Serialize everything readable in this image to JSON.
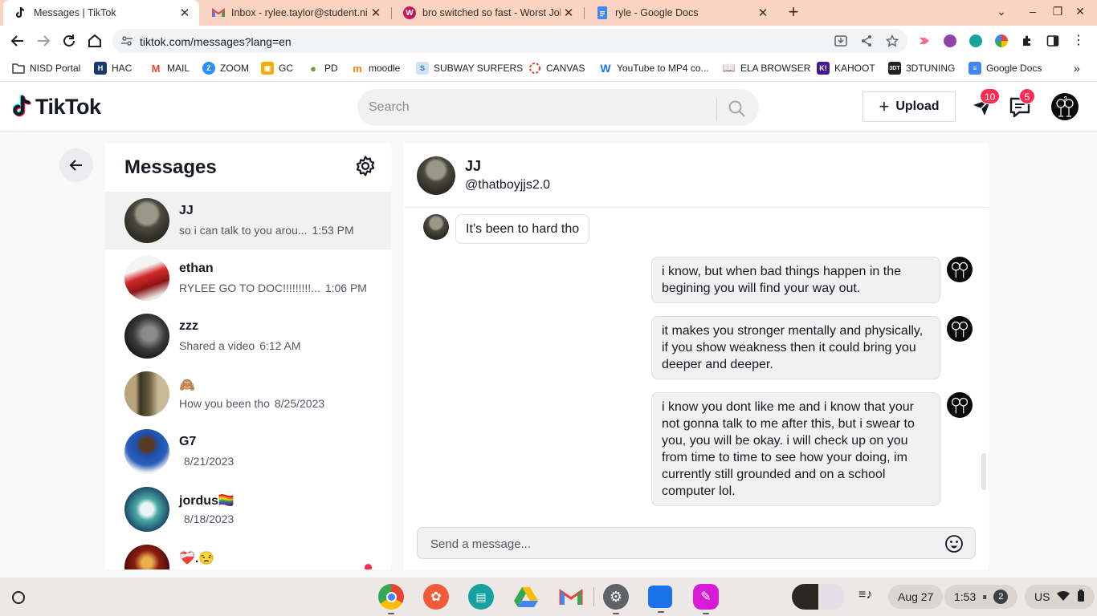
{
  "browser": {
    "tabs": [
      {
        "title": "Messages | TikTok",
        "active": true
      },
      {
        "title": "Inbox - rylee.taylor@student.nisd",
        "active": false
      },
      {
        "title": "bro switched so fast - Worst Jok",
        "active": false
      },
      {
        "title": "ryle - Google Docs",
        "active": false
      }
    ],
    "url": "tiktok.com/messages?lang=en",
    "bookmarks": [
      {
        "label": "NISD Portal"
      },
      {
        "label": "HAC"
      },
      {
        "label": "MAIL"
      },
      {
        "label": "ZOOM"
      },
      {
        "label": "GC"
      },
      {
        "label": "PD"
      },
      {
        "label": "moodle"
      },
      {
        "label": "SUBWAY SURFERS"
      },
      {
        "label": "CANVAS"
      },
      {
        "label": "YouTube to MP4 co..."
      },
      {
        "label": "ELA BROWSER"
      },
      {
        "label": "KAHOOT"
      },
      {
        "label": "3DTUNING"
      },
      {
        "label": "Google Docs"
      }
    ]
  },
  "header": {
    "brand": "TikTok",
    "search_placeholder": "Search",
    "upload_label": "Upload",
    "inbox_badge": "10",
    "messages_badge": "5"
  },
  "conversations": {
    "title": "Messages",
    "items": [
      {
        "name": "JJ",
        "preview": "so i can talk to you arou...",
        "time": "1:53 PM"
      },
      {
        "name": "ethan",
        "preview": "RYLEE GO TO DOC!!!!!!!!!...",
        "time": "1:06 PM"
      },
      {
        "name": "zzz",
        "preview": "Shared a video",
        "time": "6:12 AM"
      },
      {
        "name": "🙈",
        "preview": "How you been tho",
        "time": "8/25/2023"
      },
      {
        "name": "G7",
        "preview": "",
        "time": "8/21/2023"
      },
      {
        "name": "jordus🏳️‍🌈",
        "preview": "",
        "time": "8/18/2023"
      },
      {
        "name": "❤️‍🩹.😒",
        "preview": "",
        "time": ""
      }
    ]
  },
  "chat": {
    "name": "JJ",
    "handle": "@thatboyjjs2.0",
    "messages": [
      {
        "from": "them",
        "text": "It’s been to hard tho"
      },
      {
        "from": "me",
        "text": "i know, but when bad things happen in the begining you will find your way out."
      },
      {
        "from": "me",
        "text": "it makes you stronger mentally and physically, if you show weakness then it could bring you deeper and deeper."
      },
      {
        "from": "me",
        "text": "i know you dont like me and i know that your not gonna talk to me after this, but i swear to you, you will be okay. i will check up on you from time to time to see how your doing, im currently still grounded and on a school computer lol."
      }
    ],
    "composer_placeholder": "Send a message..."
  },
  "shelf": {
    "date": "Aug 27",
    "time": "1:53",
    "notifications": "2",
    "locale": "US"
  },
  "colors": {
    "tiktok_red": "#fe2c55",
    "tiktok_cyan": "#25f4ee",
    "tabstrip": "#fad3c2"
  }
}
